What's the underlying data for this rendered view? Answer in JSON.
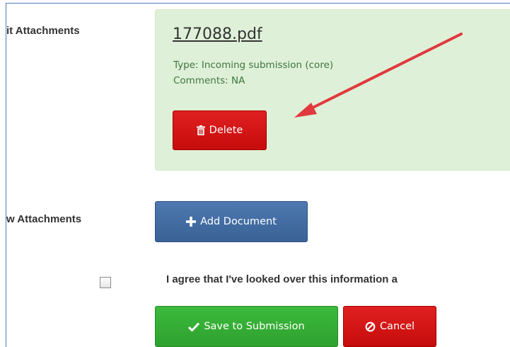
{
  "form": {
    "current_attachments_label": "it Attachments",
    "new_attachments_label": "w Attachments",
    "agree_text": "I agree that I've looked over this information a"
  },
  "attachment": {
    "filename": "177088.pdf",
    "type_line": "Type: Incoming submission (core)",
    "comments_line": "Comments: NA",
    "delete_label": "Delete"
  },
  "actions": {
    "add_document_label": "Add Document",
    "save_label": "Save to Submission",
    "cancel_label": "Cancel"
  },
  "colors": {
    "panel_bg": "#dff0d8",
    "danger": "#d01414",
    "primary": "#4470a6",
    "success": "#36ae36",
    "annotation_arrow": "#e0393e"
  },
  "icons": {
    "delete": "trash-icon",
    "add": "plus-icon",
    "save": "check-icon",
    "cancel": "ban-icon"
  }
}
